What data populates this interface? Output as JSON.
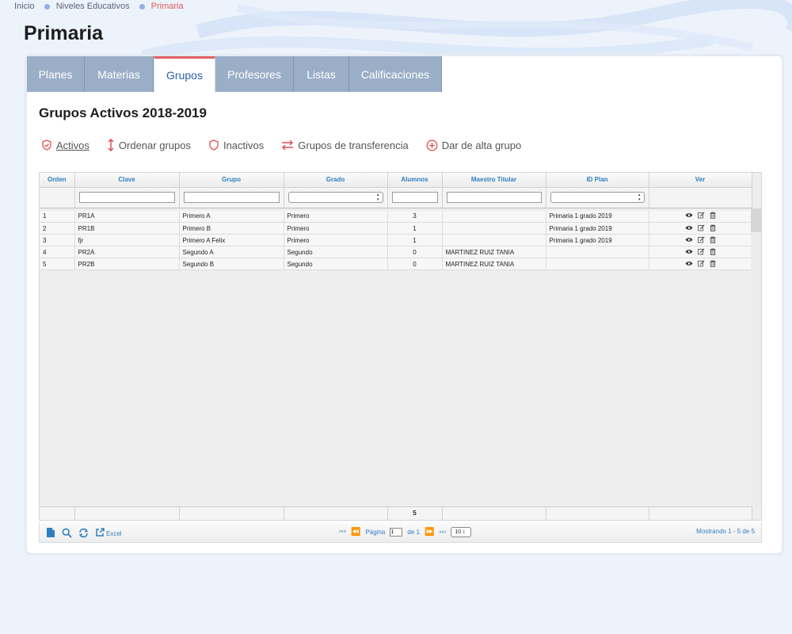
{
  "breadcrumb": {
    "home": "Inicio",
    "level": "Niveles Educativos",
    "current": "Primaria"
  },
  "page_title": "Primaria",
  "tabs": [
    {
      "label": "Planes"
    },
    {
      "label": "Materias"
    },
    {
      "label": "Grupos"
    },
    {
      "label": "Profesores"
    },
    {
      "label": "Listas"
    },
    {
      "label": "Calificaciones"
    }
  ],
  "section_title": "Grupos Activos 2018-2019",
  "toolbar": {
    "activos": "Activos",
    "ordenar": "Ordenar grupos",
    "inactivos": "Inactivos",
    "transferencia": "Grupos de transferencia",
    "alta": "Dar de alta grupo"
  },
  "grid": {
    "columns": [
      "Orden",
      "Clave",
      "Grupo",
      "Grado",
      "Alumnos",
      "Maestro Titular",
      "ID Plan",
      "Ver"
    ],
    "rows": [
      {
        "orden": "1",
        "clave": "PR1A",
        "grupo": "Primero A",
        "grado": "Primero",
        "alumnos": "3",
        "maestro": "",
        "plan": "Primaria 1 grado 2019"
      },
      {
        "orden": "2",
        "clave": "PR1B",
        "grupo": "Primero B",
        "grado": "Primero",
        "alumnos": "1",
        "maestro": "",
        "plan": "Primaria 1 grado 2019"
      },
      {
        "orden": "3",
        "clave": "fjr",
        "grupo": "Primero A Felix",
        "grado": "Primero",
        "alumnos": "1",
        "maestro": "",
        "plan": "Primaria 1 grado 2019"
      },
      {
        "orden": "4",
        "clave": "PR2A",
        "grupo": "Segundo A",
        "grado": "Segundo",
        "alumnos": "0",
        "maestro": "MARTINEZ RUIZ TANIA",
        "plan": ""
      },
      {
        "orden": "5",
        "clave": "PR2B",
        "grupo": "Segundo B",
        "grado": "Segundo",
        "alumnos": "0",
        "maestro": "MARTINEZ RUIZ TANIA",
        "plan": ""
      }
    ],
    "total_alumnos": "5"
  },
  "pager": {
    "excel": "Excel",
    "page_label": "Página",
    "page_value": "1",
    "of_label": "de 1",
    "page_size": "10",
    "status": "Mostrando 1 - 5 de 5"
  },
  "icons": {
    "view": "eye-icon",
    "edit": "edit-icon",
    "delete": "trash-icon"
  },
  "colors": {
    "accent": "#e05b5b",
    "tab_bg": "#9aafc7",
    "link": "#2f7ec0"
  }
}
